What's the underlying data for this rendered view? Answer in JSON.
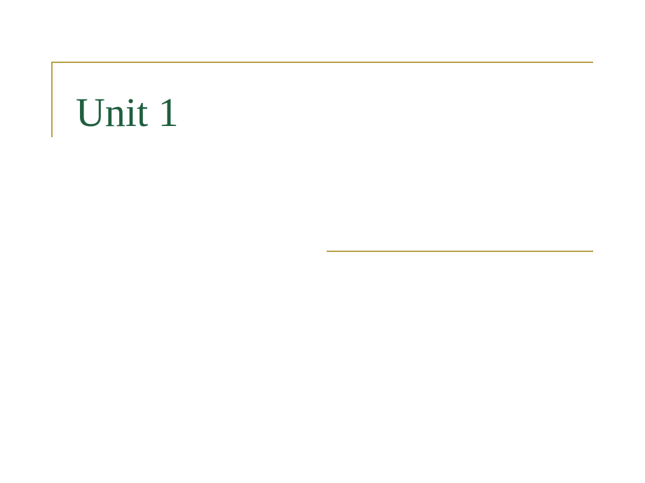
{
  "slide": {
    "title": "Unit 1"
  },
  "colors": {
    "title_text": "#1e5f3f",
    "frame_line": "#b8a04a",
    "background": "#ffffff"
  }
}
